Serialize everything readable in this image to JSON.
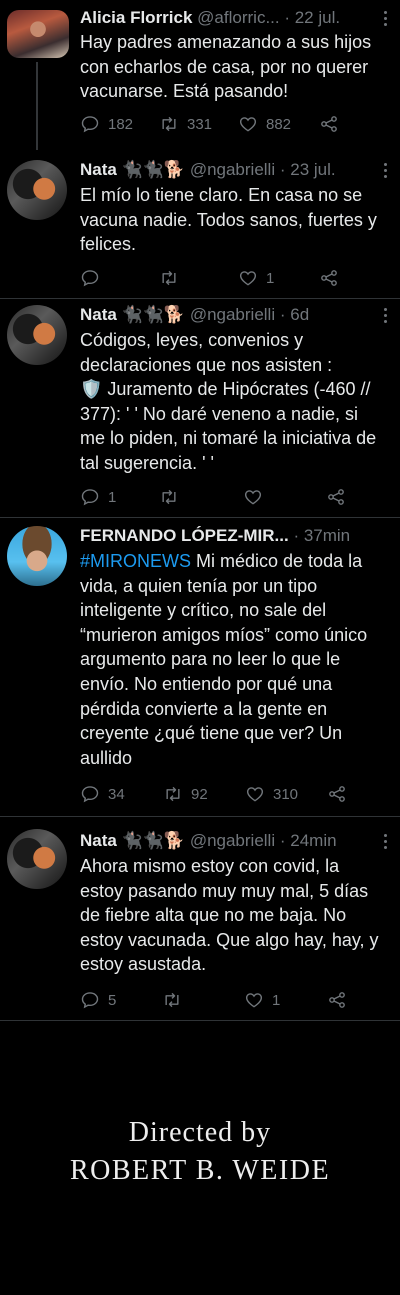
{
  "tweets": [
    {
      "name": "Alicia Florrick",
      "handle": "@aflorric...",
      "time": "· 22 jul.",
      "text": "Hay padres amenazando a sus hijos\ncon echarlos de casa, por no querer\nvacunarse. Está pasando!",
      "hashtag": "",
      "replies": "182",
      "retweets": "331",
      "likes": "882"
    },
    {
      "name": "Nata 🐈‍⬛🐈‍⬛🐕",
      "handle": "@ngabrielli",
      "time": "· 23 jul.",
      "text": "El mío lo tiene claro. En casa no se\nvacuna nadie. Todos sanos, fuertes y\nfelices.",
      "hashtag": "",
      "replies": "",
      "retweets": "",
      "likes": "1"
    },
    {
      "name": "Nata 🐈‍⬛🐈‍⬛🐕",
      "handle": "@ngabrielli",
      "time": "· 6d",
      "text": "Códigos, leyes, convenios y\ndeclaraciones que nos asisten :\n🛡️ Juramento de Hipócrates (-460 //\n377): ' ' No daré veneno a nadie, si\nme lo piden, ni tomaré la iniciativa de\ntal sugerencia.  ' '",
      "hashtag": "",
      "replies": "1",
      "retweets": "",
      "likes": ""
    },
    {
      "name": "FERNANDO LÓPEZ-MIR...",
      "handle": "",
      "time": "· 37min",
      "hashtag": "#MIRONEWS",
      "text": " Mi médico de toda la\nvida, a quien tenía por un tipo\ninteligente y crítico, no sale del\n“murieron amigos míos” como único\nargumento para no leer lo que le\nenvío. No entiendo por qué una\npérdida convierte a la gente en\ncreyente ¿qué tiene que ver? Un\naullido",
      "replies": "34",
      "retweets": "92",
      "likes": "310"
    },
    {
      "name": "Nata 🐈‍⬛🐈‍⬛🐕",
      "handle": "@ngabrielli",
      "time": "· 24min",
      "text": "Ahora mismo estoy con covid, la\nestoy pasando muy muy mal, 5 días\nde fiebre alta que no me baja. No\nestoy vacunada. Que algo hay, hay, y\nestoy asustada.",
      "hashtag": "",
      "replies": "5",
      "retweets": "",
      "likes": "1"
    }
  ],
  "credits": {
    "line1": "Directed by",
    "line2": "ROBERT B. WEIDE"
  },
  "colors": {
    "background": "#000000",
    "text": "#e7e9ea",
    "muted": "#71767b",
    "link": "#1d9bf0",
    "separator": "#2f3336"
  }
}
